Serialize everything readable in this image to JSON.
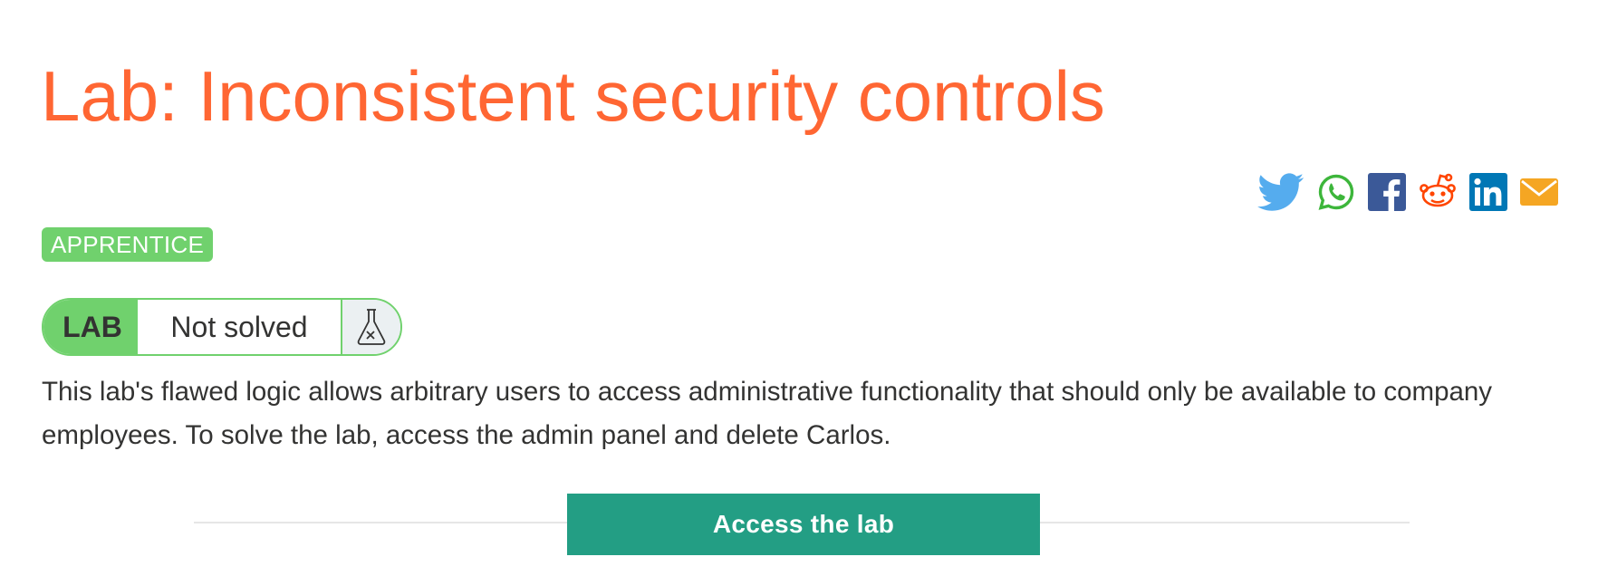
{
  "title": "Lab: Inconsistent security controls",
  "share": {
    "icons": [
      "twitter-icon",
      "whatsapp-icon",
      "facebook-icon",
      "reddit-icon",
      "linkedin-icon",
      "email-icon"
    ],
    "colors": {
      "twitter": "#55acee",
      "whatsapp": "#3db63b",
      "facebook": "#3b5998",
      "reddit": "#ff4500",
      "linkedin": "#0077b5",
      "email": "#f5a623"
    }
  },
  "level": "APPRENTICE",
  "lab_status": {
    "tag": "LAB",
    "state": "Not solved",
    "icon": "flask-icon"
  },
  "description": "This lab's flawed logic allows arbitrary users to access administrative functionality that should only be available to company employees. To solve the lab, access the admin panel and delete Carlos.",
  "access_button": "Access the lab",
  "colors": {
    "title": "#ff6633",
    "level_badge": "#70d16d",
    "button": "#239e84",
    "text": "#333332"
  }
}
